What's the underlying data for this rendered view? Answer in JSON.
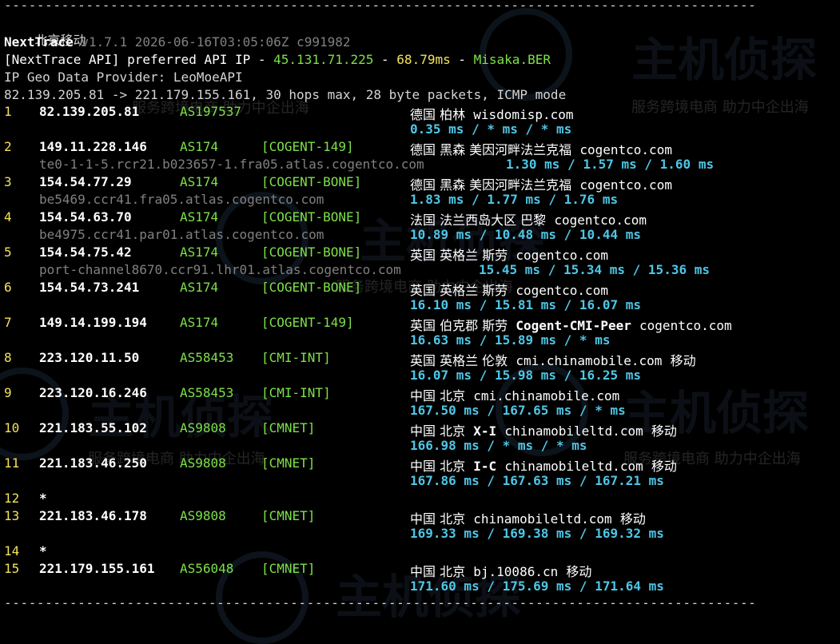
{
  "separator": "--------------------------------------------------------------------------------------------",
  "header": {
    "region": "北京移动",
    "version_label": "NextTrace",
    "version": " v1.7.1 2026-06-16T03:05:06Z c991982",
    "api_prefix": "[NextTrace API] preferred API IP - ",
    "api_ip": "45.131.71.225",
    "api_dash1": " - ",
    "api_latency": "68.79ms",
    "api_dash2": " - ",
    "api_node": "Misaka.BER",
    "geo_provider": "IP Geo Data Provider: LeoMoeAPI",
    "trace_line": "82.139.205.81 -> 221.179.155.161, 30 hops max, 28 byte packets, ICMP mode"
  },
  "hops": [
    {
      "num": "1",
      "ip": "82.139.205.81",
      "asn": "AS197537",
      "tag": "",
      "geo": "德国 柏林",
      "domain": "wisdomisp.com",
      "extra": "",
      "rdns": "",
      "rtt": "0.35 ms / * ms / * ms"
    },
    {
      "num": "2",
      "ip": "149.11.228.146",
      "asn": "AS174",
      "tag": "[COGENT-149]",
      "geo": "德国 黑森 美因河畔法兰克福",
      "domain": "cogentco.com",
      "extra": "",
      "rdns": "te0-1-1-5.rcr21.b023657-1.fra05.atlas.cogentco.com",
      "rtt": "1.30 ms / 1.57 ms / 1.60 ms"
    },
    {
      "num": "3",
      "ip": "154.54.77.29",
      "asn": "AS174",
      "tag": "[COGENT-BONE]",
      "geo": "德国 黑森 美因河畔法兰克福",
      "domain": "cogentco.com",
      "extra": "",
      "rdns": "be5469.ccr41.fra05.atlas.cogentco.com",
      "rtt": "1.83 ms / 1.77 ms / 1.76 ms"
    },
    {
      "num": "4",
      "ip": "154.54.63.70",
      "asn": "AS174",
      "tag": "[COGENT-BONE]",
      "geo": "法国 法兰西岛大区 巴黎",
      "domain": "cogentco.com",
      "extra": "",
      "rdns": "be4975.ccr41.par01.atlas.cogentco.com",
      "rtt": "10.89 ms / 10.48 ms / 10.44 ms"
    },
    {
      "num": "5",
      "ip": "154.54.75.42",
      "asn": "AS174",
      "tag": "[COGENT-BONE]",
      "geo": "英国 英格兰 斯劳",
      "domain": "cogentco.com",
      "extra": "",
      "rdns": "port-channel8670.ccr91.lhr01.atlas.cogentco.com",
      "rtt": "15.45 ms / 15.34 ms / 15.36 ms"
    },
    {
      "num": "6",
      "ip": "154.54.73.241",
      "asn": "AS174",
      "tag": "[COGENT-BONE]",
      "geo": "英国 英格兰 斯劳",
      "domain": "cogentco.com",
      "extra": "",
      "rdns": "",
      "rtt": "16.10 ms / 15.81 ms / 16.07 ms"
    },
    {
      "num": "7",
      "ip": "149.14.199.194",
      "asn": "AS174",
      "tag": "[COGENT-149]",
      "geo": "英国 伯克郡 斯劳",
      "domain": "cogentco.com",
      "extra": "Cogent-CMI-Peer",
      "rdns": "",
      "rtt": "16.63 ms / 15.89 ms / * ms"
    },
    {
      "num": "8",
      "ip": "223.120.11.50",
      "asn": "AS58453",
      "tag": "[CMI-INT]",
      "geo": "英国 英格兰 伦敦",
      "domain": "cmi.chinamobile.com",
      "extra": "移动",
      "rdns": "",
      "rtt": "16.07 ms / 15.98 ms / 16.25 ms"
    },
    {
      "num": "9",
      "ip": "223.120.16.246",
      "asn": "AS58453",
      "tag": "[CMI-INT]",
      "geo": "中国 北京",
      "domain": "cmi.chinamobile.com",
      "extra": "",
      "rdns": "",
      "rtt": "167.50 ms / 167.65 ms / * ms"
    },
    {
      "num": "10",
      "ip": "221.183.55.102",
      "asn": "AS9808",
      "tag": "[CMNET]",
      "geo": "中国 北京",
      "domain": "chinamobileltd.com",
      "extra": "移动",
      "rdns": "",
      "rtt": "166.98 ms / * ms / * ms",
      "label": "X-I"
    },
    {
      "num": "11",
      "ip": "221.183.46.250",
      "asn": "AS9808",
      "tag": "[CMNET]",
      "geo": "中国 北京",
      "domain": "chinamobileltd.com",
      "extra": "移动",
      "rdns": "",
      "rtt": "167.86 ms / 167.63 ms / 167.21 ms",
      "label": "I-C"
    },
    {
      "num": "12",
      "ip": "*",
      "asn": "",
      "tag": "",
      "geo": "",
      "domain": "",
      "extra": "",
      "rdns": "",
      "rtt": ""
    },
    {
      "num": "13",
      "ip": "221.183.46.178",
      "asn": "AS9808",
      "tag": "[CMNET]",
      "geo": "中国 北京",
      "domain": "chinamobileltd.com",
      "extra": "移动",
      "rdns": "",
      "rtt": "169.33 ms / 169.38 ms / 169.32 ms"
    },
    {
      "num": "14",
      "ip": "*",
      "asn": "",
      "tag": "",
      "geo": "",
      "domain": "",
      "extra": "",
      "rdns": "",
      "rtt": ""
    },
    {
      "num": "15",
      "ip": "221.179.155.161",
      "asn": "AS56048",
      "tag": "[CMNET]",
      "geo": "中国 北京",
      "domain": "bj.10086.cn",
      "extra": "移动",
      "rdns": "",
      "rtt": "171.60 ms / 175.69 ms / 171.64 ms"
    }
  ],
  "watermark": {
    "brand": "主机侦探",
    "slogan": "服务跨境电商 助力中企出海"
  },
  "colors": {
    "background": "#000000",
    "hop_number": "#f2e25c",
    "asn": "#7ee04a",
    "rtt": "#4fc6e6",
    "rdns": "#808080"
  }
}
